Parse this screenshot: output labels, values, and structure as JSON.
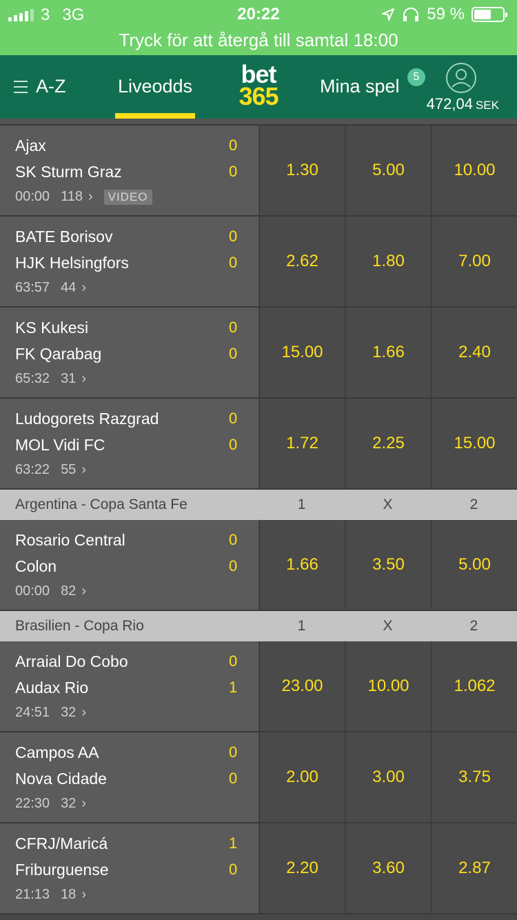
{
  "status": {
    "carrier": "3",
    "network": "3G",
    "time": "20:22",
    "battery_pct": "59 %",
    "battery_level": 0.59
  },
  "call_banner": "Tryck för att återgå till samtal 18:00",
  "header": {
    "menu_label": "A-Z",
    "live_label": "Liveodds",
    "logo_top": "bet",
    "logo_bottom": "365",
    "mina_label": "Mina spel",
    "mina_count": "5",
    "balance": "472,04",
    "currency": "SEK"
  },
  "rows": [
    {
      "type": "match",
      "home": "Ajax",
      "away": "SK Sturm Graz",
      "home_score": "0",
      "away_score": "0",
      "clock": "00:00",
      "markets": "118",
      "video": "VIDEO",
      "odds": [
        "1.30",
        "5.00",
        "10.00"
      ]
    },
    {
      "type": "match",
      "home": "BATE Borisov",
      "away": "HJK Helsingfors",
      "home_score": "0",
      "away_score": "0",
      "clock": "63:57",
      "markets": "44",
      "odds": [
        "2.62",
        "1.80",
        "7.00"
      ]
    },
    {
      "type": "match",
      "home": "KS Kukesi",
      "away": "FK Qarabag",
      "home_score": "0",
      "away_score": "0",
      "clock": "65:32",
      "markets": "31",
      "odds": [
        "15.00",
        "1.66",
        "2.40"
      ]
    },
    {
      "type": "match",
      "home": "Ludogorets Razgrad",
      "away": "MOL Vidi FC",
      "home_score": "0",
      "away_score": "0",
      "clock": "63:22",
      "markets": "55",
      "odds": [
        "1.72",
        "2.25",
        "15.00"
      ]
    },
    {
      "type": "league",
      "name": "Argentina - Copa Santa Fe",
      "cols": [
        "1",
        "X",
        "2"
      ]
    },
    {
      "type": "match",
      "home": "Rosario Central",
      "away": "Colon",
      "home_score": "0",
      "away_score": "0",
      "clock": "00:00",
      "markets": "82",
      "odds": [
        "1.66",
        "3.50",
        "5.00"
      ]
    },
    {
      "type": "league",
      "name": "Brasilien - Copa Rio",
      "cols": [
        "1",
        "X",
        "2"
      ]
    },
    {
      "type": "match",
      "home": "Arraial Do Cobo",
      "away": "Audax Rio",
      "home_score": "0",
      "away_score": "1",
      "clock": "24:51",
      "markets": "32",
      "odds": [
        "23.00",
        "10.00",
        "1.062"
      ]
    },
    {
      "type": "match",
      "home": "Campos AA",
      "away": "Nova Cidade",
      "home_score": "0",
      "away_score": "0",
      "clock": "22:30",
      "markets": "32",
      "odds": [
        "2.00",
        "3.00",
        "3.75"
      ]
    },
    {
      "type": "match",
      "home": "CFRJ/Maricá",
      "away": "Friburguense",
      "home_score": "1",
      "away_score": "0",
      "clock": "21:13",
      "markets": "18",
      "odds": [
        "2.20",
        "3.60",
        "2.87"
      ]
    }
  ],
  "icons": {
    "location": "location-arrow-icon",
    "headphones": "headphones-icon",
    "chevron": "chevron-right-icon",
    "menu": "hamburger-menu-icon",
    "account": "account-icon"
  },
  "colors": {
    "status_green": "#6ed16a",
    "header_green": "#126e51",
    "odds_yellow": "#ffdf1b",
    "league_bar": "#c4c4c4"
  }
}
